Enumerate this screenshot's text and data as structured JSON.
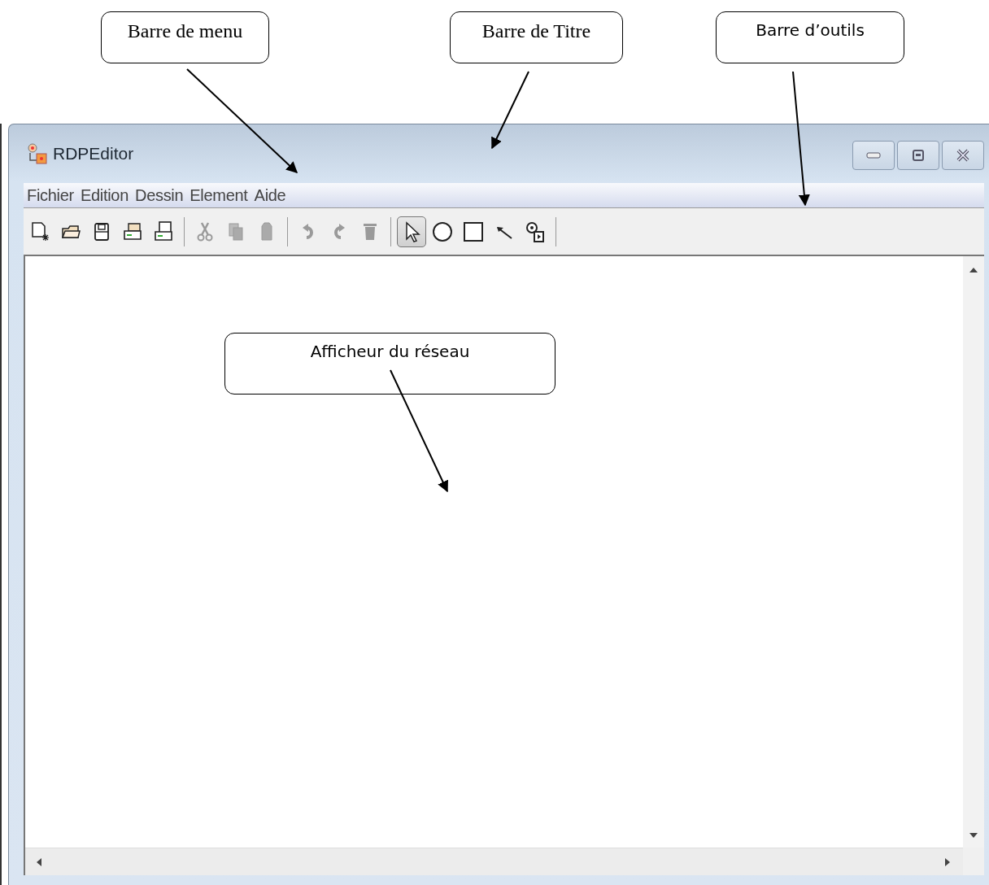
{
  "callouts": [
    {
      "label": "Barre de menu"
    },
    {
      "label": "Barre de Titre"
    },
    {
      "label": "Barre d’outils"
    },
    {
      "label": "Afficheur du réseau"
    }
  ],
  "window": {
    "title": "RDPEditor"
  },
  "menu": [
    "Fichier",
    "Edition",
    "Dessin",
    "Element",
    "Aide"
  ],
  "toolbar": [
    [
      {
        "kind": "new",
        "disabled": false,
        "selected": false
      },
      {
        "kind": "open",
        "disabled": false,
        "selected": false
      },
      {
        "kind": "save",
        "disabled": false,
        "selected": false
      },
      {
        "kind": "print",
        "disabled": false,
        "selected": false
      },
      {
        "kind": "export",
        "disabled": false,
        "selected": false
      }
    ],
    [
      {
        "kind": "cut",
        "disabled": true,
        "selected": false
      },
      {
        "kind": "copy",
        "disabled": true,
        "selected": false
      },
      {
        "kind": "paste",
        "disabled": true,
        "selected": false
      }
    ],
    [
      {
        "kind": "undo",
        "disabled": true,
        "selected": false
      },
      {
        "kind": "redo",
        "disabled": true,
        "selected": false
      },
      {
        "kind": "delete",
        "disabled": true,
        "selected": false
      }
    ],
    [
      {
        "kind": "pointer",
        "disabled": false,
        "selected": true
      },
      {
        "kind": "circle",
        "disabled": false,
        "selected": false
      },
      {
        "kind": "square",
        "disabled": false,
        "selected": false
      },
      {
        "kind": "arc",
        "disabled": false,
        "selected": false
      },
      {
        "kind": "token",
        "disabled": false,
        "selected": false
      }
    ]
  ]
}
